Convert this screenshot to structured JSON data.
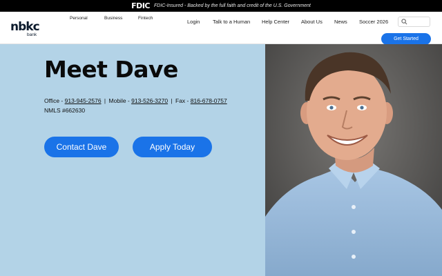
{
  "fdic_bar": {
    "logo": "FDIC",
    "text": "FDIC-Insured - Backed by the full faith and credit of the U.S. Government"
  },
  "header": {
    "logo": {
      "main": "nbkc",
      "sub": "bank"
    },
    "top_nav": [
      "Personal",
      "Business",
      "Fintech"
    ],
    "main_nav": [
      "Login",
      "Talk to a Human",
      "Help Center",
      "About Us",
      "News",
      "Soccer 2026"
    ],
    "search_placeholder": "",
    "get_started": "Get Started"
  },
  "hero": {
    "title": "Meet Dave",
    "contact": {
      "office_label": "Office - ",
      "office": "913-945-2576",
      "mobile_label": "Mobile - ",
      "mobile": "913-526-3270",
      "fax_label": "Fax - ",
      "fax": "816-678-0757"
    },
    "nmls": "NMLS #662630",
    "contact_button": "Contact Dave",
    "apply_button": "Apply Today"
  },
  "icons": {
    "search": "search-icon"
  },
  "colors": {
    "accent": "#1a73e8",
    "hero_bg": "#b3d3e7",
    "fdic_bar": "#000000"
  }
}
